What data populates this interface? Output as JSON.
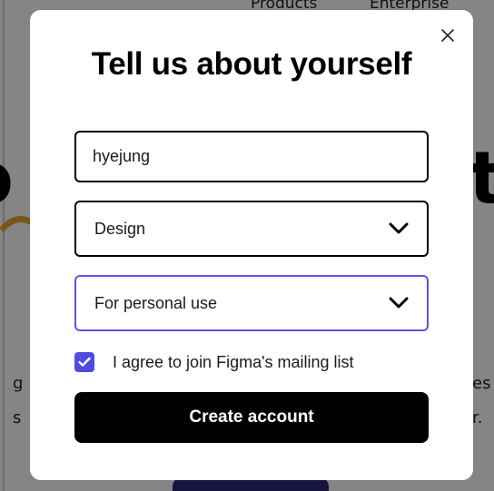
{
  "background": {
    "nav_products": "Products",
    "nav_enterprise": "Enterprise",
    "big_left": "o",
    "big_right": "t",
    "small_texts": [
      "g",
      "s",
      "es",
      "r."
    ]
  },
  "modal": {
    "title": "Tell us about yourself",
    "name_field": {
      "value": "hyejung"
    },
    "role_select": {
      "value": "Design"
    },
    "usage_select": {
      "value": "For personal use"
    },
    "mailing_checkbox": {
      "checked": true,
      "label": "I agree to join Figma's mailing list"
    },
    "create_button": "Create account"
  },
  "colors": {
    "accent": "#5a55e6",
    "checkbox": "#4f4be0",
    "button_bg": "#000000"
  }
}
